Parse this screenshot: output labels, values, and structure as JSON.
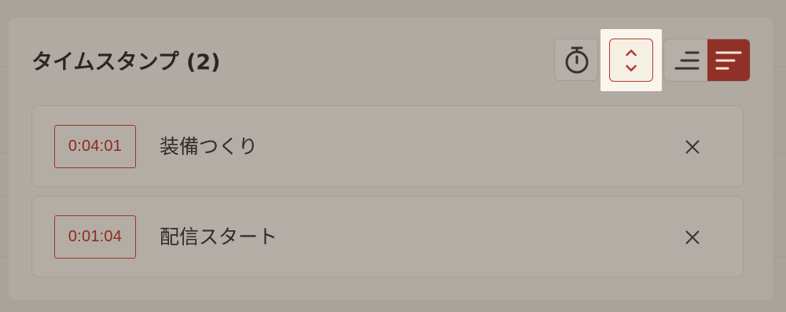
{
  "header": {
    "title": "タイムスタンプ (2)"
  },
  "toolbar": {
    "timer_icon": "stopwatch-icon",
    "sort_icon": "chevron-up-down-icon",
    "view_toggle": {
      "options": [
        "align-right-lines-icon",
        "align-left-lines-icon"
      ],
      "selected": "align-left-lines-icon"
    }
  },
  "timestamps": [
    {
      "time": "0:04:01",
      "label": "装備つくり"
    },
    {
      "time": "0:01:04",
      "label": "配信スタート"
    }
  ],
  "colors": {
    "accent": "#913027",
    "accent_text": "#8f2a21",
    "highlight": "#faf6ee",
    "panel": "#b1aaa2",
    "background": "#aaa39b"
  }
}
